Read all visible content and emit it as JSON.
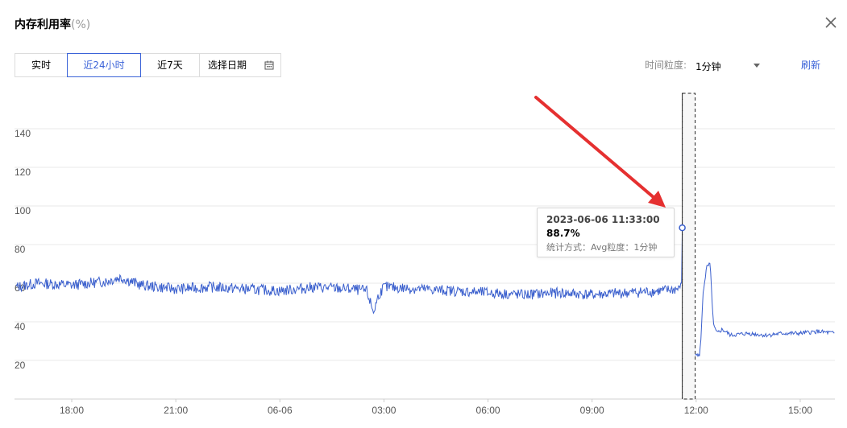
{
  "header": {
    "title": "内存利用率",
    "unit": "(%)"
  },
  "tabs": [
    {
      "label": "实时",
      "active": false
    },
    {
      "label": "近24小时",
      "active": true
    },
    {
      "label": "近7天",
      "active": false
    },
    {
      "label": "选择日期",
      "active": false,
      "icon": "calendar-icon"
    }
  ],
  "toolbar": {
    "granularity_label": "时间粒度:",
    "granularity_value": "1分钟",
    "refresh_label": "刷新"
  },
  "colors": {
    "accent": "#3b63d8",
    "line": "#3a5fcd",
    "arrow": "#e53030"
  },
  "tooltip": {
    "time": "2023-06-06 11:33:00",
    "value": "88.7%",
    "meta": "统计方式：Avg粒度：1分钟"
  },
  "chart_data": {
    "type": "line",
    "title": "内存利用率(%)",
    "ylim": [
      0,
      140
    ],
    "yticks": [
      20,
      40,
      60,
      80,
      100,
      120,
      140
    ],
    "xticks": [
      "18:00",
      "21:00",
      "06-06",
      "03:00",
      "06:00",
      "09:00",
      "12:00",
      "15:00"
    ],
    "x_range_hours": [
      16.35,
      40.0
    ],
    "grid": true,
    "series": [
      {
        "x_hours": [
          16.4,
          17.0,
          18.0,
          19.0,
          19.4,
          20.0,
          21.0,
          22.0,
          23.0,
          24.0,
          25.0,
          26.0,
          26.5,
          26.7,
          26.85,
          27.0,
          28.0,
          29.0,
          30.0,
          31.0,
          32.0,
          33.0,
          34.0,
          35.0,
          35.5,
          35.58,
          35.6,
          35.62,
          35.7,
          35.75,
          35.8,
          35.9,
          36.0,
          36.1,
          36.15,
          36.2,
          36.3,
          36.4,
          36.5,
          36.6,
          36.75,
          37.0,
          37.5,
          38.0,
          38.5,
          39.0,
          39.5,
          40.0
        ],
        "values": [
          58,
          60,
          59,
          61,
          63,
          59,
          57,
          58,
          57,
          56,
          58,
          57,
          56,
          45,
          54,
          58,
          57,
          56,
          55,
          54,
          55,
          54,
          55,
          56,
          57,
          60,
          88.7,
          88,
          86,
          40,
          22,
          23,
          24,
          22,
          35,
          55,
          68,
          70,
          38,
          34,
          36,
          33,
          34,
          33,
          34,
          34,
          35,
          34
        ],
        "tooltip_point": {
          "x_hours": 35.6,
          "value": 88.7
        }
      }
    ]
  }
}
